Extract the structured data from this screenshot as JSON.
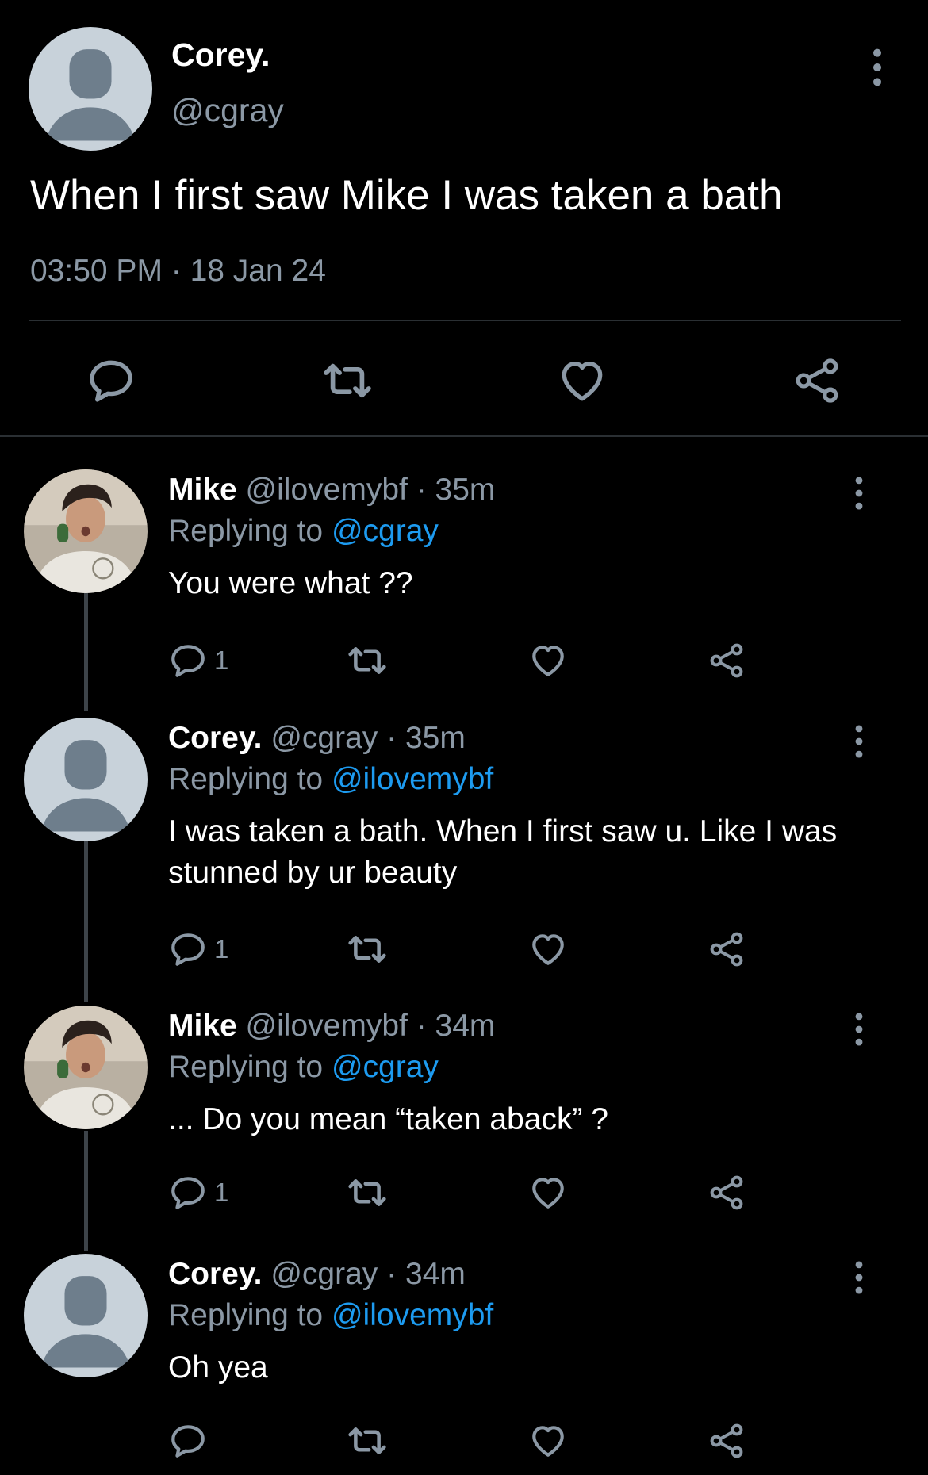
{
  "colors": {
    "background": "#000000",
    "text": "#ffffff",
    "muted": "#8b98a5",
    "link": "#1d9bf0",
    "divider": "#2a2f33"
  },
  "main_tweet": {
    "name": "Corey.",
    "handle": "@cgray",
    "text": "When I first saw Mike I was taken a bath",
    "timestamp": "03:50 PM · 18 Jan 24",
    "icons": [
      "reply-icon",
      "retweet-icon",
      "like-icon",
      "share-icon",
      "more-icon"
    ]
  },
  "replies": [
    {
      "name": "Mike",
      "meta": "@ilovemybf · 35m",
      "replying_prefix": "Replying to ",
      "replying_to": "@cgray",
      "text": "You were what ??",
      "reply_count": "1",
      "avatar": "photo"
    },
    {
      "name": "Corey.",
      "meta": "@cgray · 35m",
      "replying_prefix": "Replying to ",
      "replying_to": "@ilovemybf",
      "text": "I was taken a bath. When I first saw u. Like I was stunned by ur beauty",
      "reply_count": "1",
      "avatar": "default"
    },
    {
      "name": "Mike",
      "meta": "@ilovemybf · 34m",
      "replying_prefix": "Replying to ",
      "replying_to": "@cgray",
      "text": "... Do you mean “taken aback” ?",
      "reply_count": "1",
      "avatar": "photo"
    },
    {
      "name": "Corey.",
      "meta": "@cgray · 34m",
      "replying_prefix": "Replying to ",
      "replying_to": "@ilovemybf",
      "text": "Oh yea",
      "reply_count": "",
      "avatar": "default"
    }
  ]
}
